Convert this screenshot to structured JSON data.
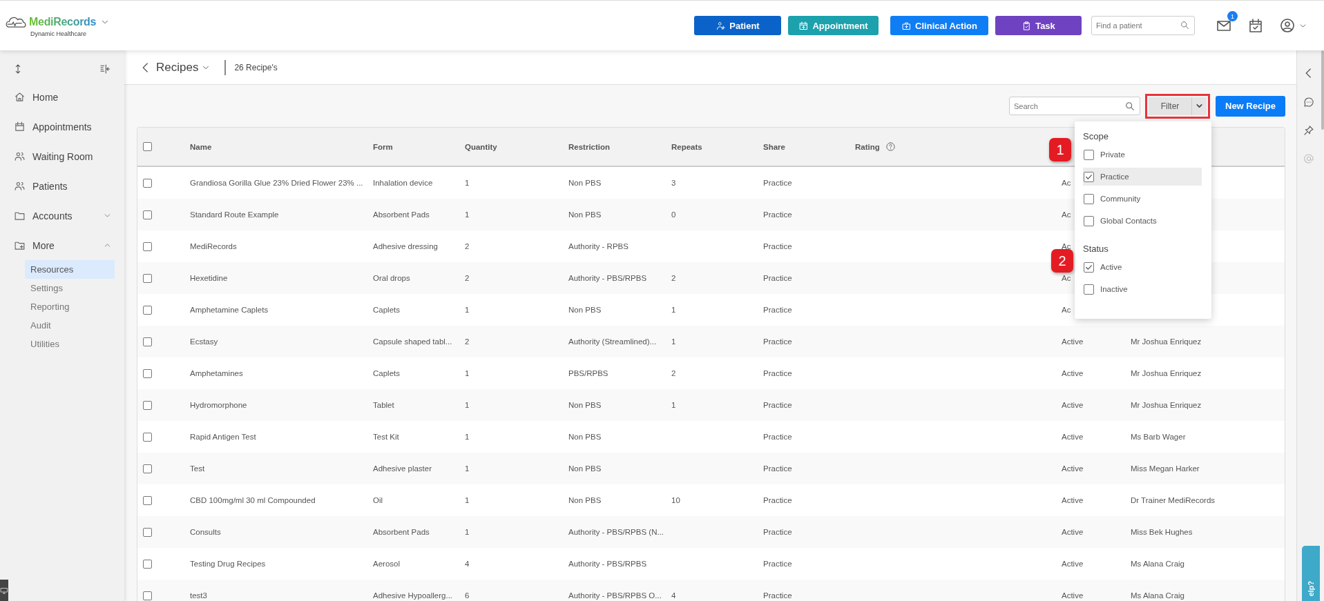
{
  "brand": {
    "name": "MediRecords",
    "subtitle": "Dynamic Healthcare"
  },
  "quick_actions": [
    {
      "label": "Patient",
      "color": "#0b63c9"
    },
    {
      "label": "Appointment",
      "color": "#1ca1ad"
    },
    {
      "label": "Clinical Action",
      "color": "#0f7ef5"
    },
    {
      "label": "Task",
      "color": "#6f42c1"
    }
  ],
  "patient_search": {
    "placeholder": "Find a patient"
  },
  "notifications": {
    "count": "1"
  },
  "sidebar": {
    "items": [
      {
        "label": "Home",
        "kind": "link"
      },
      {
        "label": "Appointments",
        "kind": "link"
      },
      {
        "label": "Waiting Room",
        "kind": "link"
      },
      {
        "label": "Patients",
        "kind": "link"
      },
      {
        "label": "Accounts",
        "kind": "group",
        "expanded": false
      },
      {
        "label": "More",
        "kind": "group",
        "expanded": true,
        "children": [
          {
            "label": "Resources",
            "selected": true
          },
          {
            "label": "Settings",
            "selected": false
          },
          {
            "label": "Reporting",
            "selected": false
          },
          {
            "label": "Audit",
            "selected": false
          },
          {
            "label": "Utilities",
            "selected": false
          }
        ]
      }
    ]
  },
  "page_header": {
    "title": "Recipes",
    "count": "26 Recipe's"
  },
  "toolbar": {
    "search": {
      "placeholder": "Search"
    },
    "filter_label": "Filter",
    "new_button": "New Recipe"
  },
  "filter_menu": {
    "sections": [
      {
        "title": "Scope",
        "callout": "1",
        "options": [
          {
            "label": "Private",
            "checked": false,
            "highlighted": false
          },
          {
            "label": "Practice",
            "checked": true,
            "highlighted": true
          },
          {
            "label": "Community",
            "checked": false,
            "highlighted": false
          },
          {
            "label": "Global Contacts",
            "checked": false,
            "highlighted": false
          }
        ]
      },
      {
        "title": "Status",
        "callout": "2",
        "options": [
          {
            "label": "Active",
            "checked": true,
            "highlighted": false
          },
          {
            "label": "Inactive",
            "checked": false,
            "highlighted": false
          }
        ]
      }
    ]
  },
  "table": {
    "all_checked": false,
    "columns": [
      "Name",
      "Form",
      "Quantity",
      "Restriction",
      "Repeats",
      "Share",
      "Rating"
    ],
    "rows": [
      {
        "checked": false,
        "name": "Grandiosa Gorilla Glue 23% Dried Flower 23% ...",
        "form": "Inhalation device",
        "quantity": "1",
        "restriction": "Non PBS",
        "repeats": "3",
        "share": "Practice",
        "status": "Ac"
      },
      {
        "checked": false,
        "name": "Standard Route Example",
        "form": "Absorbent Pads",
        "quantity": "1",
        "restriction": "Non PBS",
        "repeats": "0",
        "share": "Practice",
        "status": "Ac"
      },
      {
        "checked": false,
        "name": "MediRecords",
        "form": "Adhesive dressing",
        "quantity": "2",
        "restriction": "Authority - RPBS",
        "share": "Practice",
        "status": "Ac"
      },
      {
        "checked": false,
        "name": "Hexetidine",
        "form": "Oral drops",
        "quantity": "2",
        "restriction": "Authority - PBS/RPBS",
        "repeats": "2",
        "share": "Practice",
        "status": "Ac"
      },
      {
        "checked": false,
        "name": "Amphetamine Caplets",
        "form": "Caplets",
        "quantity": "1",
        "restriction": "Non PBS",
        "repeats": "1",
        "share": "Practice",
        "status": "Ac"
      },
      {
        "checked": false,
        "name": "Ecstasy",
        "form": "Capsule shaped tabl...",
        "quantity": "2",
        "restriction": "Authority (Streamlined)...",
        "repeats": "1",
        "share": "Practice",
        "status": "Active",
        "author": "Mr Joshua Enriquez"
      },
      {
        "checked": false,
        "name": "Amphetamines",
        "form": "Caplets",
        "quantity": "1",
        "restriction": "PBS/RPBS",
        "repeats": "2",
        "share": "Practice",
        "status": "Active",
        "author": "Mr Joshua Enriquez"
      },
      {
        "checked": false,
        "name": "Hydromorphone",
        "form": "Tablet",
        "quantity": "1",
        "restriction": "Non PBS",
        "repeats": "1",
        "share": "Practice",
        "status": "Active",
        "author": "Mr Joshua Enriquez"
      },
      {
        "checked": false,
        "name": "Rapid Antigen Test",
        "form": "Test Kit",
        "quantity": "1",
        "restriction": "Non PBS",
        "share": "Practice",
        "status": "Active",
        "author": "Ms Barb Wager"
      },
      {
        "checked": false,
        "name": "Test",
        "form": "Adhesive plaster",
        "quantity": "1",
        "restriction": "Non PBS",
        "share": "Practice",
        "status": "Active",
        "author": "Miss Megan Harker"
      },
      {
        "checked": false,
        "name": "CBD 100mg/ml 30 ml Compounded",
        "form": "Oil",
        "quantity": "1",
        "restriction": "Non PBS",
        "repeats": "10",
        "share": "Practice",
        "status": "Active",
        "author": "Dr Trainer MediRecords"
      },
      {
        "checked": false,
        "name": "Consults",
        "form": "Absorbent Pads",
        "quantity": "1",
        "restriction": "Authority - PBS/RPBS (N...",
        "share": "Practice",
        "status": "Active",
        "author": "Miss Bek Hughes"
      },
      {
        "checked": false,
        "name": "Testing Drug Recipes",
        "form": "Aerosol",
        "quantity": "4",
        "restriction": "Authority - PBS/RPBS",
        "share": "Practice",
        "status": "Active",
        "author": "Ms Alana Craig"
      },
      {
        "checked": false,
        "name": "test3",
        "form": "Adhesive Hypoallerg...",
        "quantity": "6",
        "restriction": "Authority - PBS/RPBS O...",
        "repeats": "4",
        "share": "Practice",
        "status": "Active",
        "author": "Ms Alana Craig"
      }
    ]
  },
  "help_tab": {
    "label": "elp?"
  }
}
